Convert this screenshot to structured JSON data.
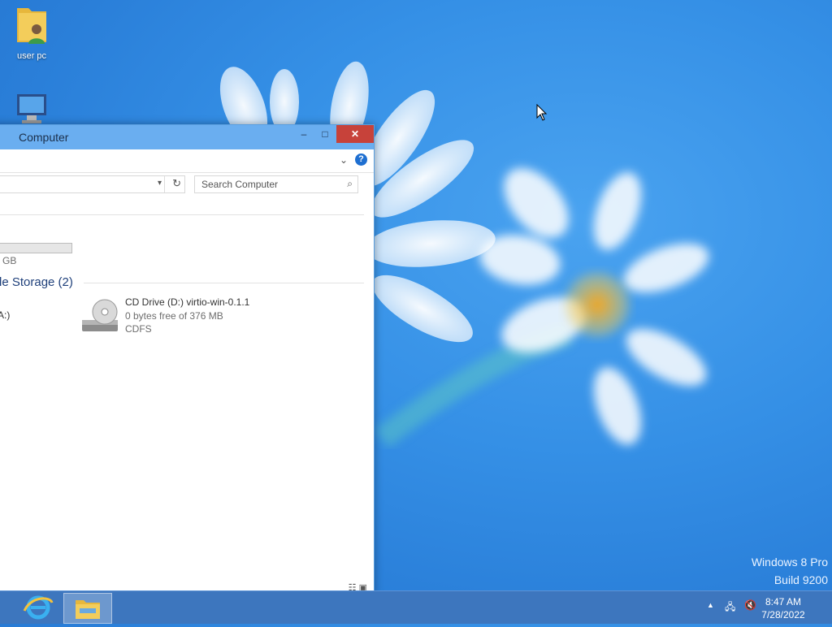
{
  "desktop": {
    "icons": [
      {
        "label": "user pc",
        "icon": "user-folder-icon"
      },
      {
        "label": "",
        "icon": "computer-icon"
      }
    ],
    "watermark": {
      "line1": "Windows 8 Pro",
      "line2": "Build 9200"
    }
  },
  "window": {
    "title": "Computer",
    "controls": {
      "minimize": "–",
      "maximize": "□",
      "close": "✕"
    },
    "help": "?",
    "search": {
      "placeholder": "Search Computer"
    },
    "hard_drive": {
      "size_fragment": "GB"
    },
    "section": {
      "label": "le Storage (2)"
    },
    "left_item_fragment": "A:)",
    "cd_drive": {
      "name": "CD Drive (D:) virtio-win-0.1.1",
      "free": "0 bytes free of 376 MB",
      "fs": "CDFS"
    }
  },
  "taskbar": {
    "apps": [
      {
        "name": "Internet Explorer",
        "icon": "internet-explorer-icon",
        "active": false
      },
      {
        "name": "File Explorer",
        "icon": "file-explorer-icon",
        "active": true
      }
    ],
    "tray": {
      "time": "8:47 AM",
      "date": "7/28/2022"
    }
  },
  "colors": {
    "accent": "#6aaef0",
    "close": "#c7423a",
    "taskbar": "#3d76be"
  }
}
